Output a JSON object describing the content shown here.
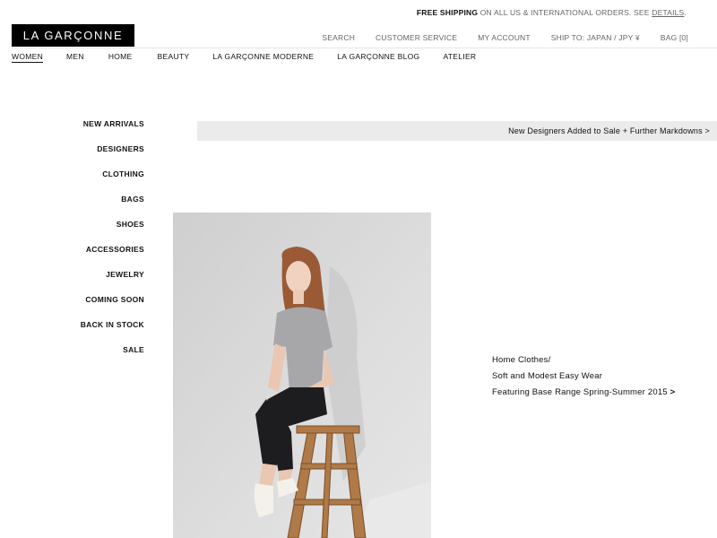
{
  "promo": {
    "bold": "FREE SHIPPING",
    "text": " ON ALL US & INTERNATIONAL ORDERS. SEE ",
    "link": "DETAILS",
    "end": "."
  },
  "logo": {
    "text": "LA GARÇONNE"
  },
  "utility_nav": {
    "search": "SEARCH",
    "customer_service": "CUSTOMER SERVICE",
    "my_account": "MY ACCOUNT",
    "ship_to": "SHIP TO: JAPAN  / JPY ¥",
    "bag": "BAG [0]"
  },
  "main_nav": {
    "items": [
      "WOMEN",
      "MEN",
      "HOME",
      "BEAUTY",
      "LA GARÇONNE MODERNE",
      "LA GARÇONNE BLOG",
      "ATELIER"
    ],
    "active": "WOMEN"
  },
  "sidebar": {
    "items": [
      "NEW ARRIVALS",
      "DESIGNERS",
      "CLOTHING",
      "BAGS",
      "SHOES",
      "ACCESSORIES",
      "JEWELRY",
      "COMING SOON",
      "BACK IN STOCK",
      "SALE"
    ]
  },
  "banner": {
    "text": "New Designers Added to Sale + Further Markdowns >"
  },
  "feature": {
    "line1": "Home Clothes/",
    "line2": "Soft and Modest Easy Wear",
    "line3": "Featuring Base Range Spring-Summer 2015",
    "arrow": ">"
  },
  "colors": {
    "banner_bg": "#ebebeb",
    "logo_bg": "#000000",
    "text": "#111111",
    "muted": "#666666"
  }
}
